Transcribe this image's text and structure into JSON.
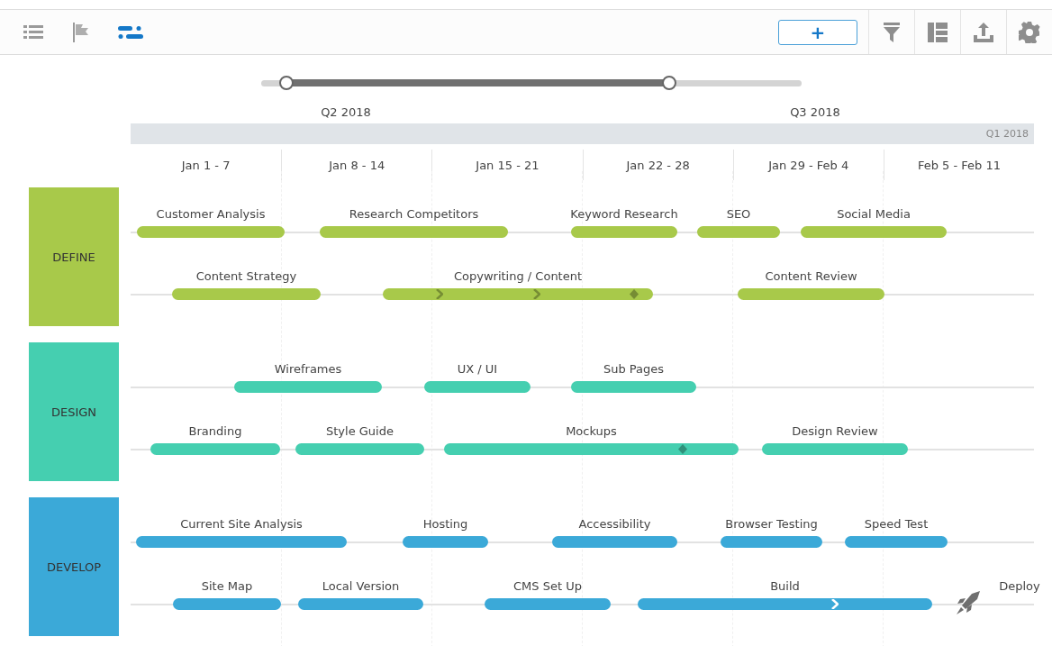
{
  "toolbar": {
    "views": [
      {
        "kind": "list",
        "selected": false
      },
      {
        "kind": "milestones",
        "selected": false
      },
      {
        "kind": "timeline",
        "selected": true
      }
    ],
    "add_button": "+",
    "tools": [
      {
        "kind": "filter"
      },
      {
        "kind": "layout"
      },
      {
        "kind": "export"
      },
      {
        "kind": "settings"
      }
    ]
  },
  "range": {
    "handles": [
      {
        "level": 0.047
      },
      {
        "level": 0.755
      }
    ],
    "labels": [
      "Q2 2018",
      "Q3 2018"
    ]
  },
  "timeline": {
    "quarter": "Q1 2018",
    "weeks": [
      "Jan 1 - 7",
      "Jan 8 - 14",
      "Jan 15 - 21",
      "Jan 22 - 28",
      "Jan 29 - Feb 4",
      "Feb 5 - Feb 11"
    ]
  },
  "groups": [
    {
      "name": "DEFINE",
      "color": "#a8c94a",
      "lanes": [
        {
          "items": [
            {
              "label": "Customer Analysis",
              "kind": "bar"
            },
            {
              "label": "Research Competitors",
              "kind": "bar"
            },
            {
              "label": "Keyword Research",
              "kind": "bar"
            },
            {
              "label": "SEO",
              "kind": "bar"
            },
            {
              "label": "Social Media",
              "kind": "bar"
            }
          ]
        },
        {
          "items": [
            {
              "label": "Content Strategy",
              "kind": "bar"
            },
            {
              "label": "Copywriting / Content",
              "kind": "bar",
              "markers": [
                {
                  "kind": "chevron"
                },
                {
                  "kind": "chevron"
                },
                {
                  "kind": "diamond"
                }
              ]
            },
            {
              "label": "Content Review",
              "kind": "bar"
            }
          ]
        }
      ]
    },
    {
      "name": "DESIGN",
      "color": "#45cfb0",
      "lanes": [
        {
          "items": [
            {
              "label": "Wireframes",
              "kind": "bar"
            },
            {
              "label": "UX / UI",
              "kind": "bar"
            },
            {
              "label": "Sub Pages",
              "kind": "bar"
            }
          ]
        },
        {
          "items": [
            {
              "label": "Branding",
              "kind": "bar"
            },
            {
              "label": "Style Guide",
              "kind": "bar"
            },
            {
              "label": "Mockups",
              "kind": "bar",
              "markers": [
                {
                  "kind": "diamond"
                }
              ]
            },
            {
              "label": "Design Review",
              "kind": "bar"
            }
          ]
        }
      ]
    },
    {
      "name": "DEVELOP",
      "color": "#3ba9d8",
      "lanes": [
        {
          "items": [
            {
              "label": "Current Site Analysis",
              "kind": "bar"
            },
            {
              "label": "Hosting",
              "kind": "bar"
            },
            {
              "label": "Accessibility",
              "kind": "bar"
            },
            {
              "label": "Browser Testing",
              "kind": "bar"
            },
            {
              "label": "Speed Test",
              "kind": "bar"
            }
          ]
        },
        {
          "items": [
            {
              "label": "Site Map",
              "kind": "bar"
            },
            {
              "label": "Local Version",
              "kind": "bar"
            },
            {
              "label": "CMS Set Up",
              "kind": "bar"
            },
            {
              "label": "Build",
              "kind": "bar",
              "markers": [
                {
                  "kind": "chevron"
                }
              ]
            },
            {
              "label": "Deploy",
              "kind": "milestone"
            }
          ]
        }
      ]
    }
  ]
}
